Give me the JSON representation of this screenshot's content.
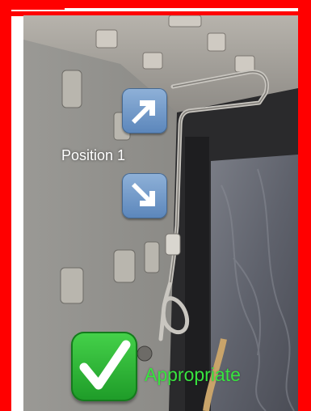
{
  "annotations": {
    "position_label": "Position 1",
    "verdict_label": "Appropriate"
  },
  "icons": {
    "upper_arrow": "arrow-up-right-icon",
    "lower_arrow": "arrow-down-right-icon",
    "verdict": "check-mark-icon"
  },
  "colors": {
    "frame": "#ff0000",
    "verdict_text": "#38e43f",
    "arrow_tile": "#6f97c8",
    "check_tile": "#2fb836"
  }
}
